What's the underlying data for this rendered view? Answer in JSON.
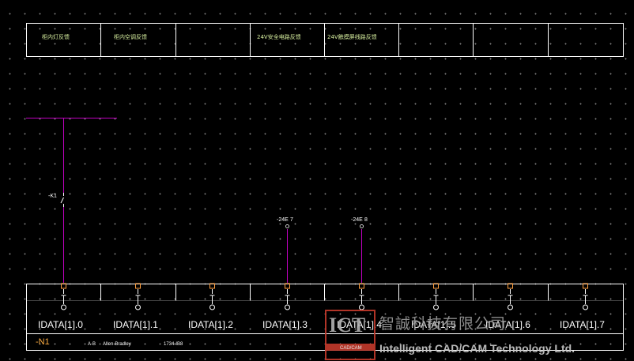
{
  "header_cells": [
    "柜内灯反馈",
    "柜内空调反馈",
    "",
    "24V安全电路反馈",
    "24V触摸屏线路反馈",
    "",
    "",
    ""
  ],
  "contact_labels": {
    "k1": "-K1",
    "c1": "-24E",
    "c1_pin": "7",
    "c2": "-24E",
    "c2_pin": "8"
  },
  "channels": [
    "IDATA[1].0",
    "IDATA[1].1",
    "IDATA[1].2",
    "IDATA[1].3",
    "IDATA[1].4",
    "IDATA[1].5",
    "IDATA[1].6",
    "IDATA[1].7"
  ],
  "module": {
    "tag": "-N1",
    "vendor_short": "A-B",
    "vendor": "Allen-Bradley",
    "part": "1734-IB8"
  },
  "watermark": {
    "logo_letters": "ICT",
    "logo_sub": "CAD/CAM",
    "cn_name": "智誠科技有限公司",
    "en_name": "Intelligent CAD/CAM Technology Ltd."
  },
  "colors": {
    "wire": "#c000c0",
    "frame": "#ffffff",
    "terminal": "#ffa040",
    "tag": "#ffae42",
    "logo_red": "#c0392b"
  }
}
